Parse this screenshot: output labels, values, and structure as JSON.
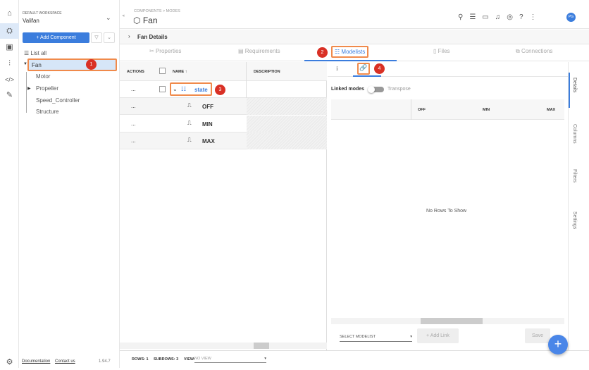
{
  "workspace": {
    "label": "DEFAULT WORKSPACE",
    "name": "Valifan"
  },
  "tree": {
    "add_button": "+ Add Component",
    "list_all": "List all",
    "items": [
      "Fan",
      "Motor",
      "Propeller",
      "Speed_Controller",
      "Structure"
    ]
  },
  "footer_left": {
    "documentation": "Documentation",
    "contact": "Contact us",
    "version": "1.94.7"
  },
  "header": {
    "breadcrumb": "COMPONENTS > MODES",
    "title": "Fan",
    "avatar": "PG"
  },
  "details_bar": "Fan Details",
  "tabs": [
    "Properties",
    "Requirements",
    "Modelists",
    "Files",
    "Connections"
  ],
  "table": {
    "headers": [
      "ACTIONS",
      "NAME",
      "DESCRIPTION"
    ],
    "parent": "state",
    "children": [
      "OFF",
      "MIN",
      "MAX"
    ],
    "actions": "..."
  },
  "right": {
    "linked_modes": "Linked modes",
    "transpose": "Transpose",
    "columns": [
      "OFF",
      "MIN",
      "MAX"
    ],
    "empty": "No Rows To Show",
    "select_modelist": "SELECT MODELIST",
    "add_link": "+ Add Link",
    "save": "Save"
  },
  "side_tabs": [
    "Details",
    "Columns",
    "Filters",
    "Settings"
  ],
  "status": {
    "rows": "ROWS: 1",
    "subrows": "SUBROWS: 3",
    "view_label": "VIEW:",
    "view": "NO VIEW"
  },
  "badges": [
    "1",
    "2",
    "3",
    "4"
  ],
  "colors": {
    "accent": "#3b7ddd",
    "highlight": "#f08a4b",
    "badge": "#d93025"
  }
}
